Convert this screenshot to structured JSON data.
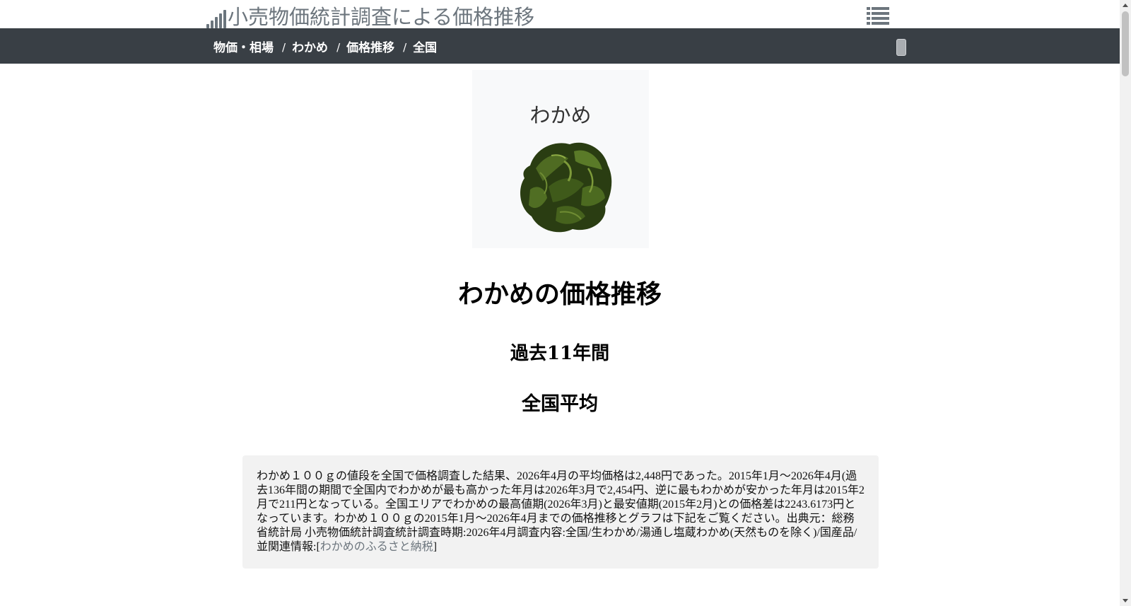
{
  "site": {
    "title": "小売物価統計調査による価格推移"
  },
  "breadcrumb": [
    {
      "label": "物価・相場"
    },
    {
      "label": "わかめ"
    },
    {
      "label": "価格推移"
    },
    {
      "label": "全国"
    }
  ],
  "breadcrumb_separator": "/",
  "product": {
    "name": "わかめ",
    "image_icon": "wakame-seaweed-image"
  },
  "headings": {
    "main": "わかめの価格推移",
    "period": "過去11年間",
    "region": "全国平均"
  },
  "description": {
    "text": "わかめ１００ｇの値段を全国で価格調査した結果、2026年4月の平均価格は2,448円であった。2015年1月～2026年4月(過去136年間の期間で全国内でわかめが最も高かった年月は2026年3月で2,454円、逆に最もわかめが安かった年月は2015年2月で211円となっている。全国エリアでわかめの最高値期(2026年3月)と最安値期(2015年2月)との価格差は2243.6173円となっています。わかめ１００ｇの2015年1月～2026年4月までの価格推移とグラフは下記をご覧ください。出典元：総務省統計局 小売物価統計調査統計調査時期:2026年4月調査内容:全国/生わかめ/湯通し塩蔵わかめ(天然ものを除く)/国産品/並関連情報:[",
    "link_label": "わかめのふるさと納税",
    "text_end": "]"
  },
  "icons": {
    "brand": "signal-bars-icon",
    "menu": "list-icon"
  },
  "colors": {
    "nav_bg": "#393f45",
    "brand_text": "#6c757d",
    "card_bg": "#f8f9fa",
    "desc_bg": "#f2f2f2",
    "link": "#6c757d"
  }
}
